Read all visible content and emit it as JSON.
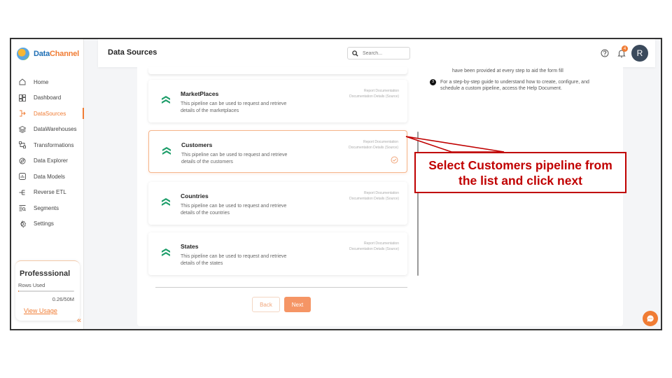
{
  "app": {
    "logo_text_primary": "Data",
    "logo_text_accent": "Channel"
  },
  "sidebar": {
    "items": [
      {
        "label": "Home",
        "icon": "home-icon"
      },
      {
        "label": "Dashboard",
        "icon": "dashboard-icon"
      },
      {
        "label": "DataSources",
        "icon": "datasources-icon",
        "active": true
      },
      {
        "label": "DataWarehouses",
        "icon": "warehouse-icon"
      },
      {
        "label": "Transformations",
        "icon": "transformations-icon"
      },
      {
        "label": "Data Explorer",
        "icon": "explorer-icon"
      },
      {
        "label": "Data Models",
        "icon": "models-icon"
      },
      {
        "label": "Reverse ETL",
        "icon": "reverse-etl-icon"
      },
      {
        "label": "Segments",
        "icon": "segments-icon"
      },
      {
        "label": "Settings",
        "icon": "settings-icon"
      }
    ],
    "plan": {
      "title": "Professsional",
      "rows_label": "Rows Used",
      "usage": "0.26/50M",
      "usage_fraction": 0.0052,
      "link": "View Usage"
    },
    "collapse_glyph": "«"
  },
  "header": {
    "title": "Data Sources",
    "search_placeholder": "Search...",
    "notification_count": "4",
    "avatar_initial": "R"
  },
  "pipelines": [
    {
      "title": "MarketPlaces",
      "description": "This pipeline can be used to request and retrieve details of the marketplaces",
      "link_report": "Report Documentation",
      "link_details": "Documentation Details (Source)",
      "selected": false
    },
    {
      "title": "Customers",
      "description": "This pipeline can be used to request and retrieve details of the customers",
      "link_report": "Report Documentation",
      "link_details": "Documentation Details (Source)",
      "selected": true
    },
    {
      "title": "Countries",
      "description": "This pipeline can be used to request and retrieve details of the countries",
      "link_report": "Report Documentation",
      "link_details": "Documentation Details (Source)",
      "selected": false
    },
    {
      "title": "States",
      "description": "This pipeline can be used to request and retrieve details of the states",
      "link_report": "Report Documentation",
      "link_details": "Documentation Details (Source)",
      "selected": false
    }
  ],
  "buttons": {
    "back": "Back",
    "next": "Next"
  },
  "instructions": {
    "partial_line": "have been provided at every step to aid the form fill",
    "step_number": "3",
    "step_text": "For a step-by-step guide to understand how to create, configure, and schedule a custom pipeline, access the Help Document."
  },
  "callout": {
    "text": "Select Customers pipeline from the list and click next",
    "color": "#c00000"
  },
  "colors": {
    "accent": "#f07c34",
    "brand": "#1f6fb5",
    "pipeline_icon": "#1e9e6a"
  }
}
